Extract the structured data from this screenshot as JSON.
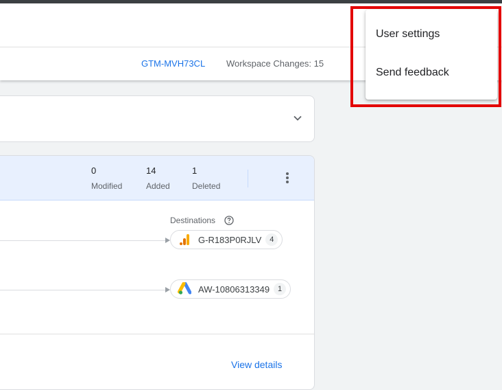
{
  "header": {
    "container_id": "GTM-MVH73CL",
    "workspace_changes": "Workspace Changes: 15"
  },
  "summary": {
    "stats": [
      {
        "value": "0",
        "label": "Modified"
      },
      {
        "value": "14",
        "label": "Added"
      },
      {
        "value": "1",
        "label": "Deleted"
      }
    ]
  },
  "destinations": {
    "label": "Destinations",
    "items": [
      {
        "id": "G-R183P0RJLV",
        "count": "4",
        "icon": "google-analytics-icon"
      },
      {
        "id": "AW-10806313349",
        "count": "1",
        "icon": "google-ads-icon"
      }
    ]
  },
  "footer": {
    "view_details": "View details"
  },
  "menu": {
    "items": [
      {
        "label": "User settings"
      },
      {
        "label": "Send feedback"
      }
    ]
  },
  "colors": {
    "accent": "#1a73e8",
    "highlight": "#e30000",
    "summary_bg": "#e8f0fe"
  }
}
